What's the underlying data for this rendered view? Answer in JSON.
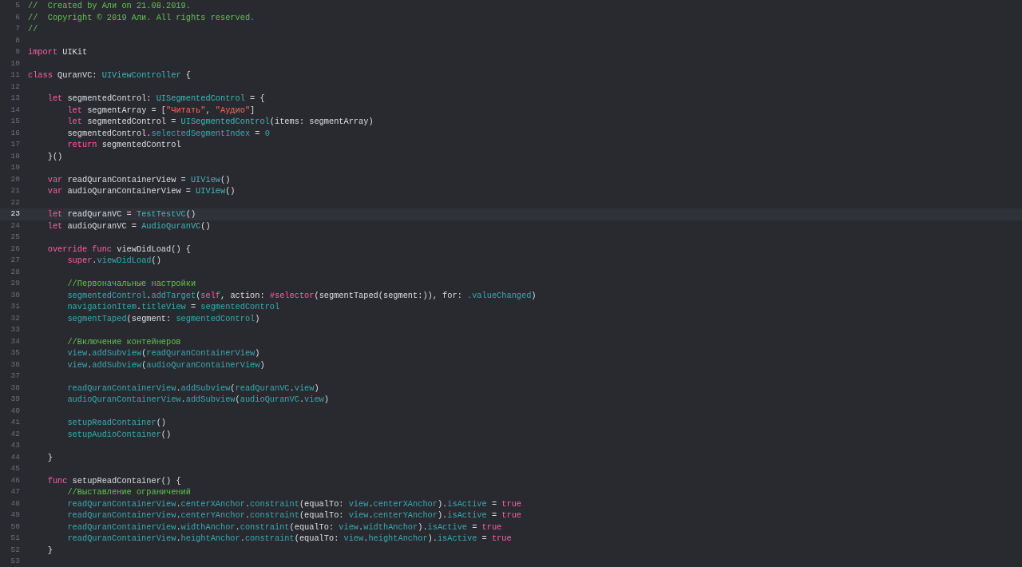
{
  "editor": {
    "lines": [
      {
        "number": "5",
        "current": false,
        "tokens": [
          {
            "kind": "comment",
            "text": "//  Created by Али on 21.08.2019."
          }
        ]
      },
      {
        "number": "6",
        "current": false,
        "tokens": [
          {
            "kind": "comment",
            "text": "//  Copyright © 2019 Али. All rights reserved."
          }
        ]
      },
      {
        "number": "7",
        "current": false,
        "tokens": [
          {
            "kind": "comment",
            "text": "//"
          }
        ]
      },
      {
        "number": "8",
        "current": false
      },
      {
        "number": "9",
        "current": false,
        "tokens": [
          {
            "kind": "keyword",
            "text": "import"
          },
          {
            "kind": "plain",
            "text": " UIKit"
          }
        ]
      },
      {
        "number": "10",
        "current": false
      },
      {
        "number": "11",
        "current": false,
        "tokens": [
          {
            "kind": "keyword",
            "text": "class"
          },
          {
            "kind": "plain",
            "text": " QuranVC: "
          },
          {
            "kind": "type",
            "text": "UIViewController"
          },
          {
            "kind": "plain",
            "text": " {"
          }
        ]
      },
      {
        "number": "12",
        "current": false
      },
      {
        "number": "13",
        "current": false,
        "tokens": [
          {
            "kind": "keyword",
            "text": "    let"
          },
          {
            "kind": "plain",
            "text": " segmentedControl: "
          },
          {
            "kind": "type",
            "text": "UISegmentedControl"
          },
          {
            "kind": "plain",
            "text": " = {"
          }
        ]
      },
      {
        "number": "14",
        "current": false,
        "tokens": [
          {
            "kind": "keyword",
            "text": "        let"
          },
          {
            "kind": "plain",
            "text": " segmentArray = ["
          },
          {
            "kind": "string",
            "text": "\"Читать\""
          },
          {
            "kind": "plain",
            "text": ", "
          },
          {
            "kind": "string",
            "text": "\"Аудио\""
          },
          {
            "kind": "plain",
            "text": "]"
          }
        ]
      },
      {
        "number": "15",
        "current": false,
        "tokens": [
          {
            "kind": "keyword",
            "text": "        let"
          },
          {
            "kind": "plain",
            "text": " segmentedControl = "
          },
          {
            "kind": "type",
            "text": "UISegmentedControl"
          },
          {
            "kind": "plain",
            "text": "(items: segmentArray)"
          }
        ]
      },
      {
        "number": "16",
        "current": false,
        "tokens": [
          {
            "kind": "plain",
            "text": "        segmentedControl."
          },
          {
            "kind": "member",
            "text": "selectedSegmentIndex"
          },
          {
            "kind": "plain",
            "text": " = "
          },
          {
            "kind": "member",
            "text": "0"
          }
        ]
      },
      {
        "number": "17",
        "current": false,
        "tokens": [
          {
            "kind": "keyword",
            "text": "        return"
          },
          {
            "kind": "plain",
            "text": " segmentedControl"
          }
        ]
      },
      {
        "number": "18",
        "current": false,
        "tokens": [
          {
            "kind": "plain",
            "text": "    }()"
          }
        ]
      },
      {
        "number": "19",
        "current": false
      },
      {
        "number": "20",
        "current": false,
        "tokens": [
          {
            "kind": "keyword",
            "text": "    var"
          },
          {
            "kind": "plain",
            "text": " readQuranContainerView = "
          },
          {
            "kind": "type",
            "text": "UIView"
          },
          {
            "kind": "plain",
            "text": "()"
          }
        ]
      },
      {
        "number": "21",
        "current": false,
        "tokens": [
          {
            "kind": "keyword",
            "text": "    var"
          },
          {
            "kind": "plain",
            "text": " audioQuranContainerView = "
          },
          {
            "kind": "type",
            "text": "UIView"
          },
          {
            "kind": "plain",
            "text": "()"
          }
        ]
      },
      {
        "number": "22",
        "current": false
      },
      {
        "number": "23",
        "current": true,
        "tokens": [
          {
            "kind": "keyword",
            "text": "    let"
          },
          {
            "kind": "plain",
            "text": " readQuranVC = "
          },
          {
            "kind": "type",
            "text": "TestTestVC"
          },
          {
            "kind": "plain",
            "text": "()"
          }
        ]
      },
      {
        "number": "24",
        "current": false,
        "tokens": [
          {
            "kind": "keyword",
            "text": "    let"
          },
          {
            "kind": "plain",
            "text": " audioQuranVC = "
          },
          {
            "kind": "type",
            "text": "AudioQuranVC"
          },
          {
            "kind": "plain",
            "text": "()"
          }
        ]
      },
      {
        "number": "25",
        "current": false
      },
      {
        "number": "26",
        "current": false,
        "tokens": [
          {
            "kind": "keyword",
            "text": "    override func"
          },
          {
            "kind": "plain",
            "text": " viewDidLoad() {"
          }
        ]
      },
      {
        "number": "27",
        "current": false,
        "tokens": [
          {
            "kind": "keyword",
            "text": "        super"
          },
          {
            "kind": "plain",
            "text": "."
          },
          {
            "kind": "member",
            "text": "viewDidLoad"
          },
          {
            "kind": "plain",
            "text": "()"
          }
        ]
      },
      {
        "number": "28",
        "current": false
      },
      {
        "number": "29",
        "current": false,
        "tokens": [
          {
            "kind": "comment",
            "text": "        //Первоначальные настройки"
          }
        ]
      },
      {
        "number": "30",
        "current": false,
        "tokens": [
          {
            "kind": "member",
            "text": "        segmentedControl"
          },
          {
            "kind": "plain",
            "text": "."
          },
          {
            "kind": "member",
            "text": "addTarget"
          },
          {
            "kind": "plain",
            "text": "("
          },
          {
            "kind": "keyword",
            "text": "self"
          },
          {
            "kind": "plain",
            "text": ", action: "
          },
          {
            "kind": "keyword",
            "text": "#selector"
          },
          {
            "kind": "plain",
            "text": "(segmentTaped(segment:)), for: "
          },
          {
            "kind": "member",
            "text": ".valueChanged"
          },
          {
            "kind": "plain",
            "text": ")"
          }
        ]
      },
      {
        "number": "31",
        "current": false,
        "tokens": [
          {
            "kind": "member",
            "text": "        navigationItem"
          },
          {
            "kind": "plain",
            "text": "."
          },
          {
            "kind": "member",
            "text": "titleView"
          },
          {
            "kind": "plain",
            "text": " = "
          },
          {
            "kind": "member",
            "text": "segmentedControl"
          }
        ]
      },
      {
        "number": "32",
        "current": false,
        "tokens": [
          {
            "kind": "member",
            "text": "        segmentTaped"
          },
          {
            "kind": "plain",
            "text": "(segment: "
          },
          {
            "kind": "member",
            "text": "segmentedControl"
          },
          {
            "kind": "plain",
            "text": ")"
          }
        ]
      },
      {
        "number": "33",
        "current": false
      },
      {
        "number": "34",
        "current": false,
        "tokens": [
          {
            "kind": "comment",
            "text": "        //Включение контейнеров"
          }
        ]
      },
      {
        "number": "35",
        "current": false,
        "tokens": [
          {
            "kind": "member",
            "text": "        view"
          },
          {
            "kind": "plain",
            "text": "."
          },
          {
            "kind": "member",
            "text": "addSubview"
          },
          {
            "kind": "plain",
            "text": "("
          },
          {
            "kind": "member",
            "text": "readQuranContainerView"
          },
          {
            "kind": "plain",
            "text": ")"
          }
        ]
      },
      {
        "number": "36",
        "current": false,
        "tokens": [
          {
            "kind": "member",
            "text": "        view"
          },
          {
            "kind": "plain",
            "text": "."
          },
          {
            "kind": "member",
            "text": "addSubview"
          },
          {
            "kind": "plain",
            "text": "("
          },
          {
            "kind": "member",
            "text": "audioQuranContainerView"
          },
          {
            "kind": "plain",
            "text": ")"
          }
        ]
      },
      {
        "number": "37",
        "current": false
      },
      {
        "number": "38",
        "current": false,
        "tokens": [
          {
            "kind": "member",
            "text": "        readQuranContainerView"
          },
          {
            "kind": "plain",
            "text": "."
          },
          {
            "kind": "member",
            "text": "addSubview"
          },
          {
            "kind": "plain",
            "text": "("
          },
          {
            "kind": "member",
            "text": "readQuranVC"
          },
          {
            "kind": "plain",
            "text": "."
          },
          {
            "kind": "member",
            "text": "view"
          },
          {
            "kind": "plain",
            "text": ")"
          }
        ]
      },
      {
        "number": "39",
        "current": false,
        "tokens": [
          {
            "kind": "member",
            "text": "        audioQuranContainerView"
          },
          {
            "kind": "plain",
            "text": "."
          },
          {
            "kind": "member",
            "text": "addSubview"
          },
          {
            "kind": "plain",
            "text": "("
          },
          {
            "kind": "member",
            "text": "audioQuranVC"
          },
          {
            "kind": "plain",
            "text": "."
          },
          {
            "kind": "member",
            "text": "view"
          },
          {
            "kind": "plain",
            "text": ")"
          }
        ]
      },
      {
        "number": "40",
        "current": false
      },
      {
        "number": "41",
        "current": false,
        "tokens": [
          {
            "kind": "member",
            "text": "        setupReadContainer"
          },
          {
            "kind": "plain",
            "text": "()"
          }
        ]
      },
      {
        "number": "42",
        "current": false,
        "tokens": [
          {
            "kind": "member",
            "text": "        setupAudioContainer"
          },
          {
            "kind": "plain",
            "text": "()"
          }
        ]
      },
      {
        "number": "43",
        "current": false
      },
      {
        "number": "44",
        "current": false,
        "tokens": [
          {
            "kind": "plain",
            "text": "    }"
          }
        ]
      },
      {
        "number": "45",
        "current": false
      },
      {
        "number": "46",
        "current": false,
        "tokens": [
          {
            "kind": "keyword",
            "text": "    func"
          },
          {
            "kind": "plain",
            "text": " setupReadContainer() {"
          }
        ]
      },
      {
        "number": "47",
        "current": false,
        "tokens": [
          {
            "kind": "comment",
            "text": "        //Выставление ограничений"
          }
        ]
      },
      {
        "number": "48",
        "current": false,
        "tokens": [
          {
            "kind": "member",
            "text": "        readQuranContainerView"
          },
          {
            "kind": "plain",
            "text": "."
          },
          {
            "kind": "member",
            "text": "centerXAnchor"
          },
          {
            "kind": "plain",
            "text": "."
          },
          {
            "kind": "member",
            "text": "constraint"
          },
          {
            "kind": "plain",
            "text": "(equalTo: "
          },
          {
            "kind": "member",
            "text": "view"
          },
          {
            "kind": "plain",
            "text": "."
          },
          {
            "kind": "member",
            "text": "centerXAnchor"
          },
          {
            "kind": "plain",
            "text": ")."
          },
          {
            "kind": "member",
            "text": "isActive"
          },
          {
            "kind": "plain",
            "text": " = "
          },
          {
            "kind": "keyword",
            "text": "true"
          }
        ]
      },
      {
        "number": "49",
        "current": false,
        "tokens": [
          {
            "kind": "member",
            "text": "        readQuranContainerView"
          },
          {
            "kind": "plain",
            "text": "."
          },
          {
            "kind": "member",
            "text": "centerYAnchor"
          },
          {
            "kind": "plain",
            "text": "."
          },
          {
            "kind": "member",
            "text": "constraint"
          },
          {
            "kind": "plain",
            "text": "(equalTo: "
          },
          {
            "kind": "member",
            "text": "view"
          },
          {
            "kind": "plain",
            "text": "."
          },
          {
            "kind": "member",
            "text": "centerYAnchor"
          },
          {
            "kind": "plain",
            "text": ")."
          },
          {
            "kind": "member",
            "text": "isActive"
          },
          {
            "kind": "plain",
            "text": " = "
          },
          {
            "kind": "keyword",
            "text": "true"
          }
        ]
      },
      {
        "number": "50",
        "current": false,
        "tokens": [
          {
            "kind": "member",
            "text": "        readQuranContainerView"
          },
          {
            "kind": "plain",
            "text": "."
          },
          {
            "kind": "member",
            "text": "widthAnchor"
          },
          {
            "kind": "plain",
            "text": "."
          },
          {
            "kind": "member",
            "text": "constraint"
          },
          {
            "kind": "plain",
            "text": "(equalTo: "
          },
          {
            "kind": "member",
            "text": "view"
          },
          {
            "kind": "plain",
            "text": "."
          },
          {
            "kind": "member",
            "text": "widthAnchor"
          },
          {
            "kind": "plain",
            "text": ")."
          },
          {
            "kind": "member",
            "text": "isActive"
          },
          {
            "kind": "plain",
            "text": " = "
          },
          {
            "kind": "keyword",
            "text": "true"
          }
        ]
      },
      {
        "number": "51",
        "current": false,
        "tokens": [
          {
            "kind": "member",
            "text": "        readQuranContainerView"
          },
          {
            "kind": "plain",
            "text": "."
          },
          {
            "kind": "member",
            "text": "heightAnchor"
          },
          {
            "kind": "plain",
            "text": "."
          },
          {
            "kind": "member",
            "text": "constraint"
          },
          {
            "kind": "plain",
            "text": "(equalTo: "
          },
          {
            "kind": "member",
            "text": "view"
          },
          {
            "kind": "plain",
            "text": "."
          },
          {
            "kind": "member",
            "text": "heightAnchor"
          },
          {
            "kind": "plain",
            "text": ")."
          },
          {
            "kind": "member",
            "text": "isActive"
          },
          {
            "kind": "plain",
            "text": " = "
          },
          {
            "kind": "keyword",
            "text": "true"
          }
        ]
      },
      {
        "number": "52",
        "current": false,
        "tokens": [
          {
            "kind": "plain",
            "text": "    }"
          }
        ]
      },
      {
        "number": "53",
        "current": false
      }
    ]
  }
}
